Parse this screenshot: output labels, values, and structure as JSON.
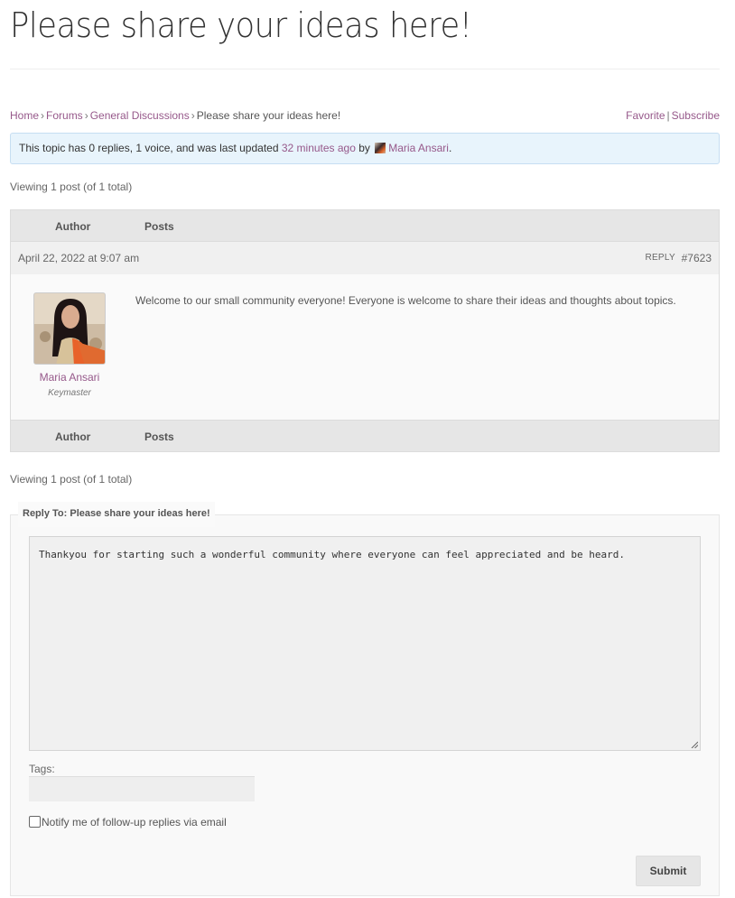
{
  "page": {
    "title": "Please share your ideas here!"
  },
  "breadcrumb": {
    "home": "Home",
    "forums": "Forums",
    "general": "General Discussions",
    "current": "Please share your ideas here!",
    "separator": "›"
  },
  "actions": {
    "favorite": "Favorite",
    "separator": "|",
    "subscribe": "Subscribe"
  },
  "notice": {
    "prefix": "This topic has 0 replies, 1 voice, and was last updated ",
    "time": "32 minutes ago",
    "by": " by ",
    "user": "Maria Ansari",
    "suffix": "."
  },
  "pagination": {
    "top": "Viewing 1 post (of 1 total)",
    "bottom": "Viewing 1 post (of 1 total)"
  },
  "table": {
    "col_author": "Author",
    "col_posts": "Posts"
  },
  "post": {
    "date": "April 22, 2022 at 9:07 am",
    "reply_label": "REPLY",
    "id": "#7623",
    "author_name": "Maria Ansari",
    "author_role": "Keymaster",
    "content": "Welcome to our small community everyone! Everyone is welcome to share their ideas and thoughts about topics."
  },
  "reply_form": {
    "legend": "Reply To: Please share your ideas here!",
    "text": "Thankyou for starting such a wonderful community where everyone can feel appreciated and be heard.",
    "tags_label": "Tags:",
    "tags_value": "",
    "notify_label": "Notify me of follow-up replies via email",
    "notify_checked": false,
    "submit_label": "Submit"
  },
  "colors": {
    "link": "#96588a",
    "notice_bg": "#e8f4fc",
    "header_bg": "#e6e6e6"
  }
}
